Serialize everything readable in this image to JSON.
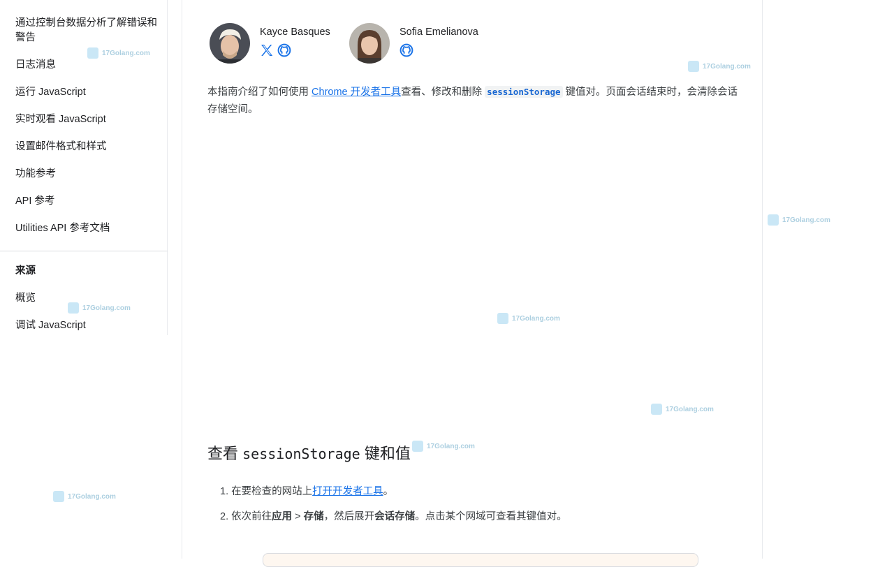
{
  "sidebar": {
    "items": [
      {
        "label": "通过控制台数据分析了解错误和警告"
      },
      {
        "label": "日志消息"
      },
      {
        "label": "运行 JavaScript"
      },
      {
        "label": "实时观看 JavaScript"
      },
      {
        "label": "设置邮件格式和样式"
      },
      {
        "label": "功能参考"
      },
      {
        "label": "API 参考"
      },
      {
        "label": "Utilities API 参考文档"
      }
    ],
    "section_title": "来源",
    "section_items": [
      {
        "label": "概览"
      },
      {
        "label": "调试 JavaScript"
      }
    ]
  },
  "authors": [
    {
      "name": "Kayce Basques",
      "social": [
        "x-icon",
        "github-icon"
      ]
    },
    {
      "name": "Sofia Emelianova",
      "social": [
        "github-icon"
      ]
    }
  ],
  "intro": {
    "before_link": "本指南介绍了如何使用 ",
    "link": "Chrome 开发者工具",
    "middle": "查看、修改和删除 ",
    "code": "sessionStorage",
    "after_code": " 键值对。页面会话结束时，会清除会话存储空间。"
  },
  "section": {
    "heading_prefix": "查看 ",
    "heading_code": "sessionStorage",
    "heading_suffix": " 键和值"
  },
  "steps": [
    {
      "number": "1.",
      "before": "在要检查的网站上",
      "link": "打开开发者工具",
      "after": "。"
    },
    {
      "number": "2.",
      "before": "依次前往",
      "bold1": "应用",
      "sep": " > ",
      "bold2": "存储",
      "middle": "，然后展开",
      "bold3": "会话存储",
      "after": "。点击某个网域可查看其键值对。"
    }
  ],
  "watermark": {
    "text": "17Golang.com"
  },
  "colors": {
    "link": "#1a73e8",
    "text": "#202124",
    "divider": "#dadce0"
  }
}
